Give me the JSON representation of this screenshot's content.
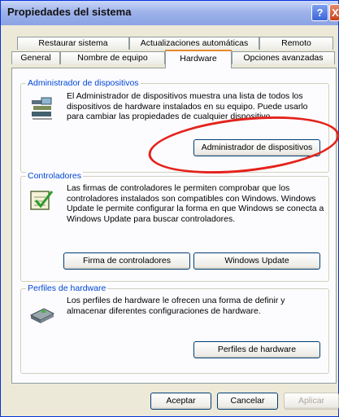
{
  "window": {
    "title": "Propiedades del sistema",
    "help_label": "?",
    "close_label": "X"
  },
  "tabs": {
    "row1": [
      "Restaurar sistema",
      "Actualizaciones automáticas",
      "Remoto"
    ],
    "row2": [
      "General",
      "Nombre de equipo",
      "Hardware",
      "Opciones avanzadas"
    ],
    "active": "Hardware"
  },
  "device_manager": {
    "label": "Administrador de dispositivos",
    "text": "El Administrador de dispositivos muestra una lista de todos los dispositivos de hardware instalados en su equipo. Puede usarlo para cambiar las propiedades de cualquier dispositivo.",
    "button": "Administrador de dispositivos",
    "icon": "device-manager-icon"
  },
  "drivers": {
    "label": "Controladores",
    "text": "Las firmas de controladores le permiten comprobar que los controladores instalados son compatibles con Windows. Windows Update le permite configurar la forma en que Windows se conecta a Windows Update para buscar controladores.",
    "button_signing": "Firma de controladores",
    "button_update": "Windows Update",
    "icon": "driver-checklist-icon"
  },
  "profiles": {
    "label": "Perfiles de hardware",
    "text": "Los perfiles de hardware le ofrecen una forma de definir y almacenar diferentes configuraciones de hardware.",
    "button": "Perfiles de hardware",
    "icon": "hardware-profile-icon"
  },
  "footer": {
    "ok": "Aceptar",
    "cancel": "Cancelar",
    "apply": "Aplicar"
  },
  "annotation": {
    "color": "#e4231b"
  }
}
